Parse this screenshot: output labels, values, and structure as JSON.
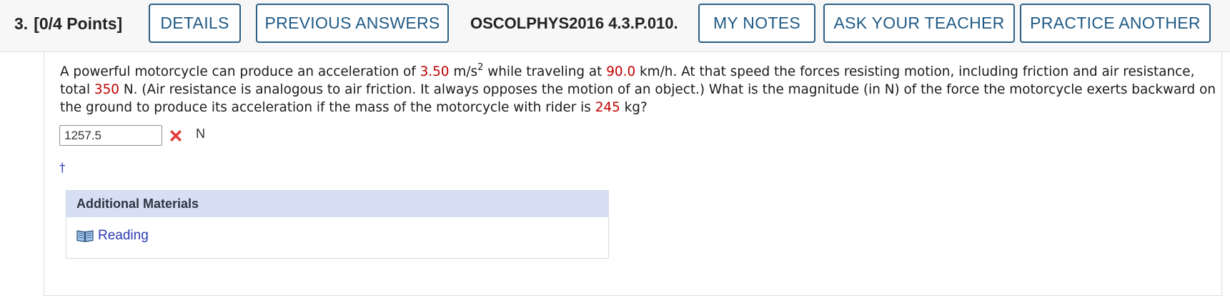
{
  "header": {
    "question_number": "3.",
    "points": "[0/4 Points]",
    "details_label": "DETAILS",
    "previous_answers_label": "PREVIOUS ANSWERS",
    "problem_id": "OSCOLPHYS2016 4.3.P.010.",
    "my_notes_label": "MY NOTES",
    "ask_teacher_label": "ASK YOUR TEACHER",
    "practice_another_label": "PRACTICE ANOTHER"
  },
  "question": {
    "t1": "A powerful motorcycle can produce an acceleration of ",
    "v1": "3.50",
    "t2": " m/s",
    "sup": "2",
    "t3": " while traveling at ",
    "v2": "90.0",
    "t4": " km/h. At that speed the forces resisting motion, including friction and air resistance, total ",
    "v3": "350",
    "t5": " N. (Air resistance is analogous to air friction. It always opposes the motion of an object.) What is the magnitude (in N) of the force the motorcycle exerts backward on the ground to produce its acceleration if the mass of the motorcycle with rider is ",
    "v4": "245",
    "t6": " kg?"
  },
  "answer": {
    "value": "1257.5",
    "unit": "N",
    "status": "incorrect"
  },
  "footnote_marker": "†",
  "additional_materials": {
    "title": "Additional Materials",
    "link_label": "Reading"
  },
  "colors": {
    "accent": "#1f5a86",
    "value_red": "#c00000",
    "link_blue": "#2b3bb3",
    "panel_header": "#d7dff5"
  }
}
